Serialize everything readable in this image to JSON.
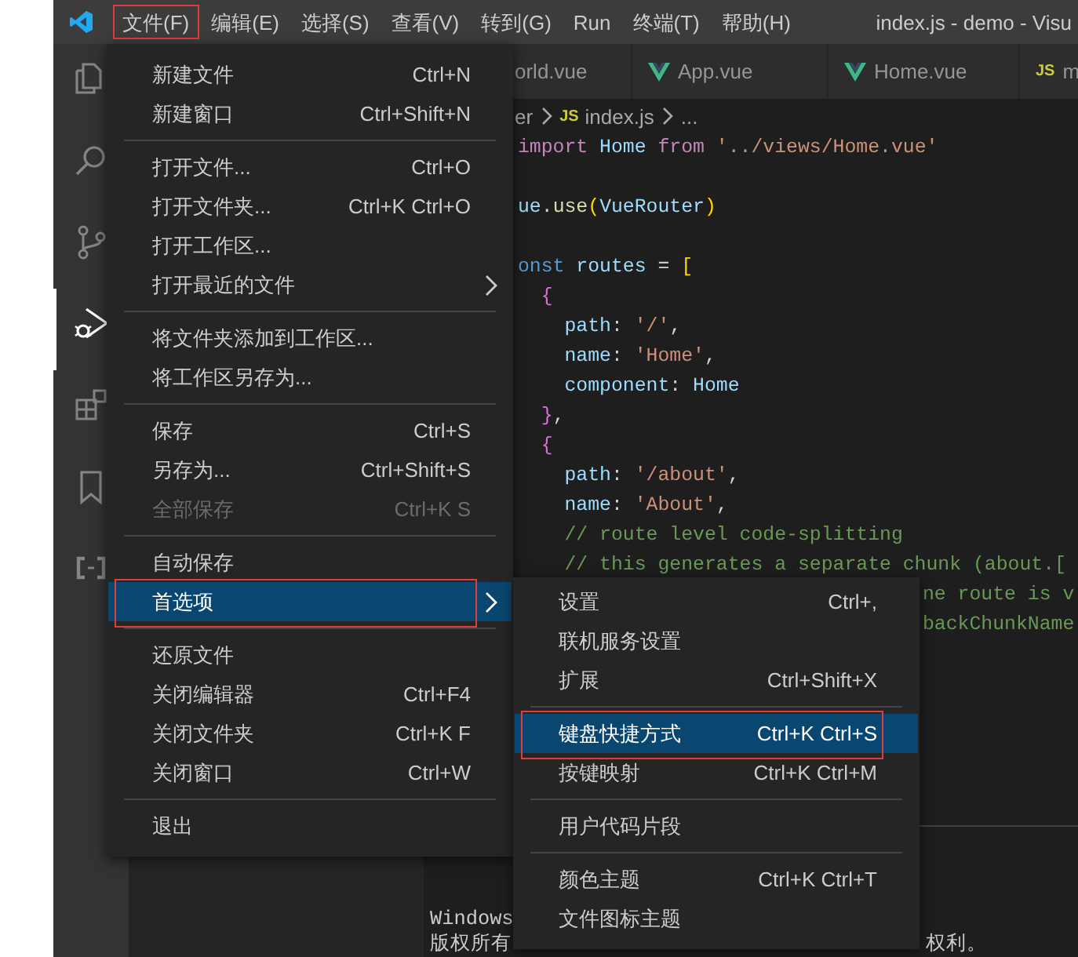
{
  "window": {
    "title": "index.js - demo - Visu"
  },
  "menubar": [
    {
      "label": "文件(F)",
      "outlined": true
    },
    {
      "label": "编辑(E)",
      "outlined": false
    },
    {
      "label": "选择(S)",
      "outlined": false
    },
    {
      "label": "查看(V)",
      "outlined": false
    },
    {
      "label": "转到(G)",
      "outlined": false
    },
    {
      "label": "Run",
      "outlined": false
    },
    {
      "label": "终端(T)",
      "outlined": false
    },
    {
      "label": "帮助(H)",
      "outlined": false
    }
  ],
  "activity_bar": [
    {
      "selected": false
    },
    {
      "selected": false
    },
    {
      "selected": false
    },
    {
      "selected": true
    },
    {
      "selected": false
    },
    {
      "selected": false
    },
    {
      "selected": false
    }
  ],
  "tabs": [
    {
      "label": "orld.vue"
    },
    {
      "kind": "vue",
      "label": "App.vue"
    },
    {
      "kind": "vue",
      "label": "Home.vue"
    },
    {
      "kind": "js",
      "badge": "JS",
      "label": "m"
    }
  ],
  "breadcrumb": [
    {
      "label": "er"
    },
    {
      "badge": "JS",
      "label": "index.js"
    },
    {
      "label": "..."
    }
  ],
  "code": [
    {
      "kind": "code",
      "tokens": [
        {
          "kind": "keyword",
          "text": "import"
        },
        {
          "kind": "variable",
          "text": " Home"
        },
        {
          "kind": "keyword",
          "text": " from"
        },
        {
          "kind": "string",
          "text": " '../views/Home.vue'"
        }
      ]
    },
    {
      "kind": "code"
    },
    {
      "kind": "code",
      "tokens": [
        {
          "kind": "variable",
          "text": "ue"
        },
        {
          "kind": "punct",
          "text": "."
        },
        {
          "kind": "function",
          "text": "use"
        },
        {
          "kind": "bracket",
          "text": "("
        },
        {
          "kind": "variable",
          "text": "VueRouter"
        },
        {
          "kind": "bracket",
          "text": ")"
        }
      ]
    },
    {
      "kind": "code"
    },
    {
      "kind": "code",
      "tokens": [
        {
          "kind": "storage",
          "text": "onst"
        },
        {
          "kind": "variable",
          "text": " routes"
        },
        {
          "kind": "punct",
          "text": " ="
        },
        {
          "kind": "bracket",
          "text": " ["
        }
      ]
    },
    {
      "kind": "code",
      "tokens": [
        {
          "kind": "brace",
          "text": "  {"
        }
      ]
    },
    {
      "kind": "code",
      "tokens": [
        {
          "kind": "variable",
          "text": "    path"
        },
        {
          "kind": "punct",
          "text": ": "
        },
        {
          "kind": "string",
          "text": "'/'"
        },
        {
          "kind": "punct",
          "text": ","
        }
      ]
    },
    {
      "kind": "code",
      "tokens": [
        {
          "kind": "variable",
          "text": "    name"
        },
        {
          "kind": "punct",
          "text": ": "
        },
        {
          "kind": "string",
          "text": "'Home'"
        },
        {
          "kind": "punct",
          "text": ","
        }
      ]
    },
    {
      "kind": "code",
      "tokens": [
        {
          "kind": "variable",
          "text": "    component"
        },
        {
          "kind": "punct",
          "text": ": "
        },
        {
          "kind": "variable",
          "text": "Home"
        }
      ]
    },
    {
      "kind": "code",
      "tokens": [
        {
          "kind": "brace",
          "text": "  }"
        },
        {
          "kind": "punct",
          "text": ","
        }
      ]
    },
    {
      "kind": "code",
      "tokens": [
        {
          "kind": "brace",
          "text": "  {"
        }
      ]
    },
    {
      "kind": "code",
      "tokens": [
        {
          "kind": "variable",
          "text": "    path"
        },
        {
          "kind": "punct",
          "text": ": "
        },
        {
          "kind": "string",
          "text": "'/about'"
        },
        {
          "kind": "punct",
          "text": ","
        }
      ]
    },
    {
      "kind": "code",
      "tokens": [
        {
          "kind": "variable",
          "text": "    name"
        },
        {
          "kind": "punct",
          "text": ": "
        },
        {
          "kind": "string",
          "text": "'About'"
        },
        {
          "kind": "punct",
          "text": ","
        }
      ]
    },
    {
      "kind": "code",
      "tokens": [
        {
          "kind": "comment",
          "text": "    // route level code-splitting"
        }
      ]
    },
    {
      "kind": "code",
      "tokens": [
        {
          "kind": "comment",
          "text": "    // this generates a separate chunk (about.["
        }
      ]
    },
    {
      "kind": "covered",
      "tokens": [
        {
          "kind": "comment",
          "text": "ne route is v"
        }
      ]
    },
    {
      "kind": "covered",
      "tokens": [
        {
          "kind": "comment",
          "text": "backChunkName"
        }
      ]
    }
  ],
  "terminal": {
    "lines": [
      {
        "segments": [
          {
            "kind": "plain",
            "text": "Windows"
          }
        ]
      },
      {
        "segments": [
          {
            "kind": "plain",
            "text": "版权所有"
          },
          {
            "kind": "covered",
            "text": "权利。"
          }
        ]
      }
    ]
  },
  "file_menu": {
    "items": [
      {
        "kind": "item",
        "label": "新建文件",
        "shortcut": "Ctrl+N",
        "submenu": false,
        "selected": false,
        "disabled": false,
        "outlined": false
      },
      {
        "kind": "item",
        "label": "新建窗口",
        "shortcut": "Ctrl+Shift+N",
        "submenu": false,
        "selected": false,
        "disabled": false,
        "outlined": false
      },
      {
        "kind": "separator"
      },
      {
        "kind": "item",
        "label": "打开文件...",
        "shortcut": "Ctrl+O",
        "submenu": false,
        "selected": false,
        "disabled": false,
        "outlined": false
      },
      {
        "kind": "item",
        "label": "打开文件夹...",
        "shortcut": "Ctrl+K Ctrl+O",
        "submenu": false,
        "selected": false,
        "disabled": false,
        "outlined": false
      },
      {
        "kind": "item",
        "label": "打开工作区...",
        "submenu": false,
        "selected": false,
        "disabled": false,
        "outlined": false
      },
      {
        "kind": "item",
        "label": "打开最近的文件",
        "submenu": true,
        "selected": false,
        "disabled": false,
        "outlined": false
      },
      {
        "kind": "separator"
      },
      {
        "kind": "item",
        "label": "将文件夹添加到工作区...",
        "submenu": false,
        "selected": false,
        "disabled": false,
        "outlined": false
      },
      {
        "kind": "item",
        "label": "将工作区另存为...",
        "submenu": false,
        "selected": false,
        "disabled": false,
        "outlined": false
      },
      {
        "kind": "separator"
      },
      {
        "kind": "item",
        "label": "保存",
        "shortcut": "Ctrl+S",
        "submenu": false,
        "selected": false,
        "disabled": false,
        "outlined": false
      },
      {
        "kind": "item",
        "label": "另存为...",
        "shortcut": "Ctrl+Shift+S",
        "submenu": false,
        "selected": false,
        "disabled": false,
        "outlined": false
      },
      {
        "kind": "item",
        "label": "全部保存",
        "shortcut": "Ctrl+K S",
        "submenu": false,
        "selected": false,
        "disabled": true,
        "outlined": false
      },
      {
        "kind": "separator"
      },
      {
        "kind": "item",
        "label": "自动保存",
        "submenu": false,
        "selected": false,
        "disabled": false,
        "outlined": false
      },
      {
        "kind": "item",
        "label": "首选项",
        "submenu": true,
        "selected": true,
        "disabled": false,
        "outlined": true
      },
      {
        "kind": "separator"
      },
      {
        "kind": "item",
        "label": "还原文件",
        "submenu": false,
        "selected": false,
        "disabled": false,
        "outlined": false
      },
      {
        "kind": "item",
        "label": "关闭编辑器",
        "shortcut": "Ctrl+F4",
        "submenu": false,
        "selected": false,
        "disabled": false,
        "outlined": false
      },
      {
        "kind": "item",
        "label": "关闭文件夹",
        "shortcut": "Ctrl+K F",
        "submenu": false,
        "selected": false,
        "disabled": false,
        "outlined": false
      },
      {
        "kind": "item",
        "label": "关闭窗口",
        "shortcut": "Ctrl+W",
        "submenu": false,
        "selected": false,
        "disabled": false,
        "outlined": false
      },
      {
        "kind": "separator"
      },
      {
        "kind": "item",
        "label": "退出",
        "submenu": false,
        "selected": false,
        "disabled": false,
        "outlined": false
      }
    ]
  },
  "preferences_menu": {
    "items": [
      {
        "kind": "item",
        "label": "设置",
        "shortcut": "Ctrl+,",
        "submenu": false,
        "selected": false,
        "disabled": false,
        "outlined": false
      },
      {
        "kind": "item",
        "label": "联机服务设置",
        "submenu": false,
        "selected": false,
        "disabled": false,
        "outlined": false
      },
      {
        "kind": "item",
        "label": "扩展",
        "shortcut": "Ctrl+Shift+X",
        "submenu": false,
        "selected": false,
        "disabled": false,
        "outlined": false
      },
      {
        "kind": "separator"
      },
      {
        "kind": "item",
        "label": "键盘快捷方式",
        "shortcut": "Ctrl+K Ctrl+S",
        "submenu": false,
        "selected": true,
        "disabled": false,
        "outlined": true
      },
      {
        "kind": "item",
        "label": "按键映射",
        "shortcut": "Ctrl+K Ctrl+M",
        "submenu": false,
        "selected": false,
        "disabled": false,
        "outlined": false
      },
      {
        "kind": "separator"
      },
      {
        "kind": "item",
        "label": "用户代码片段",
        "submenu": false,
        "selected": false,
        "disabled": false,
        "outlined": false
      },
      {
        "kind": "separator"
      },
      {
        "kind": "item",
        "label": "颜色主题",
        "shortcut": "Ctrl+K Ctrl+T",
        "submenu": false,
        "selected": false,
        "disabled": false,
        "outlined": false
      },
      {
        "kind": "item",
        "label": "文件图标主题",
        "submenu": false,
        "selected": false,
        "disabled": false,
        "outlined": false
      }
    ]
  }
}
